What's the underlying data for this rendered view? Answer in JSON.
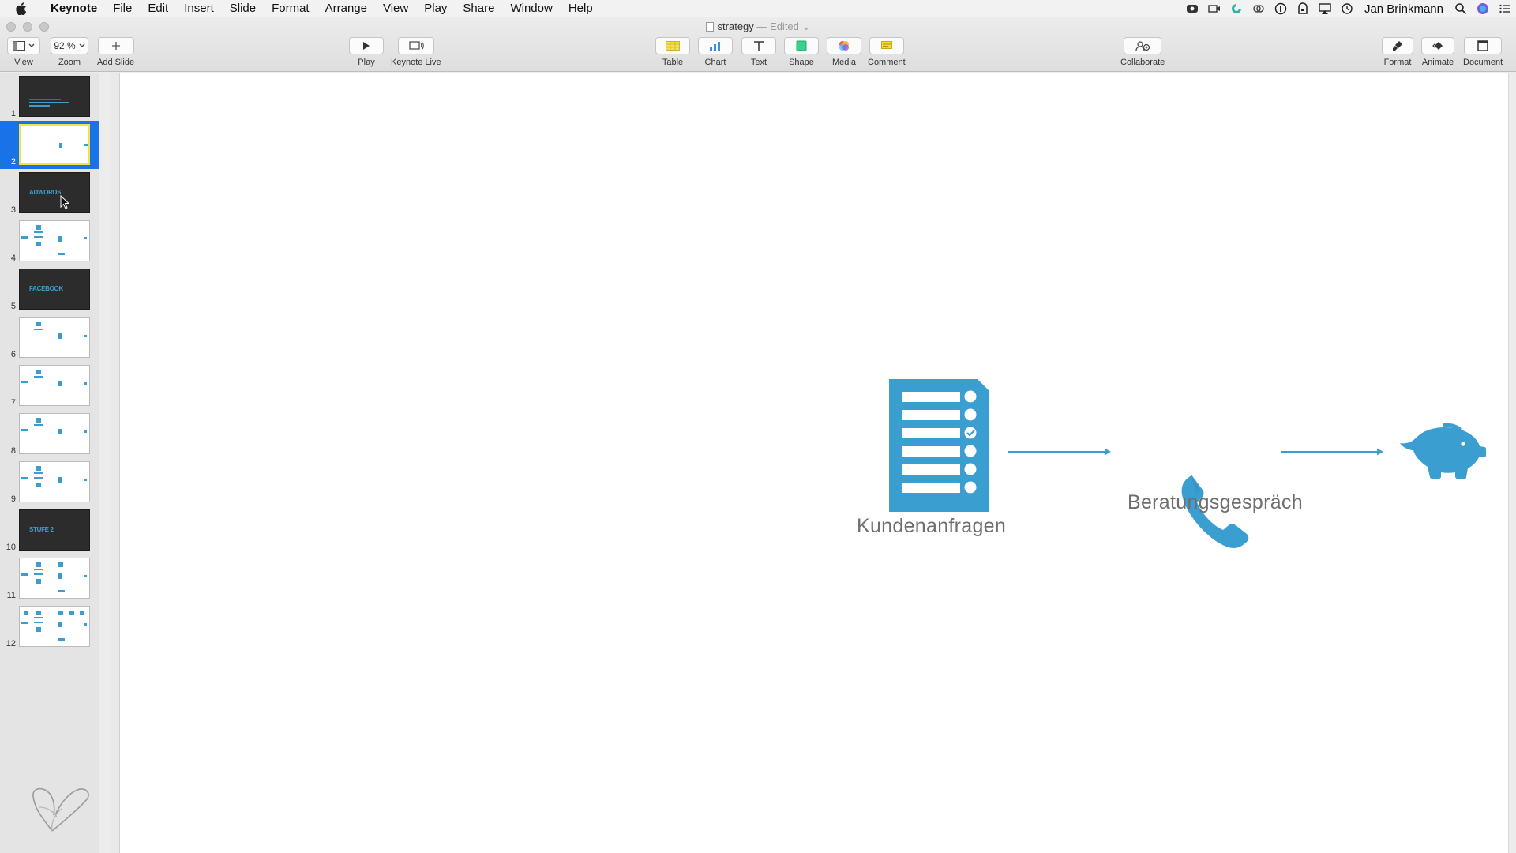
{
  "menubar": {
    "app": "Keynote",
    "items": [
      "File",
      "Edit",
      "Insert",
      "Slide",
      "Format",
      "Arrange",
      "View",
      "Play",
      "Share",
      "Window",
      "Help"
    ],
    "user": "Jan Brinkmann"
  },
  "window": {
    "title": "strategy",
    "status": "— Edited"
  },
  "toolbar": {
    "view_label": "View",
    "zoom_value": "92 %",
    "zoom_label": "Zoom",
    "add_slide_label": "Add Slide",
    "play_label": "Play",
    "keynote_live_label": "Keynote Live",
    "table_label": "Table",
    "chart_label": "Chart",
    "text_label": "Text",
    "shape_label": "Shape",
    "media_label": "Media",
    "comment_label": "Comment",
    "collaborate_label": "Collaborate",
    "format_label": "Format",
    "animate_label": "Animate",
    "document_label": "Document"
  },
  "slides": [
    {
      "number": "1",
      "kind": "dark-title"
    },
    {
      "number": "2",
      "kind": "flow",
      "selected": true
    },
    {
      "number": "3",
      "kind": "dark",
      "title": "ADWORDS"
    },
    {
      "number": "4",
      "kind": "flow-large"
    },
    {
      "number": "5",
      "kind": "dark",
      "title": "FACEBOOK"
    },
    {
      "number": "6",
      "kind": "flow-medium"
    },
    {
      "number": "7",
      "kind": "flow-medium"
    },
    {
      "number": "8",
      "kind": "flow-medium"
    },
    {
      "number": "9",
      "kind": "flow-large"
    },
    {
      "number": "10",
      "kind": "dark",
      "title": "STUFE 2"
    },
    {
      "number": "11",
      "kind": "flow-large"
    },
    {
      "number": "12",
      "kind": "flow-xl"
    }
  ],
  "canvas": {
    "label_requests": "Kundenanfragen",
    "label_consultation": "Beratungsgespräch",
    "accent": "#3a9fd0",
    "icons": [
      "document-checklist-icon",
      "phone-icon",
      "piggy-bank-icon"
    ]
  }
}
